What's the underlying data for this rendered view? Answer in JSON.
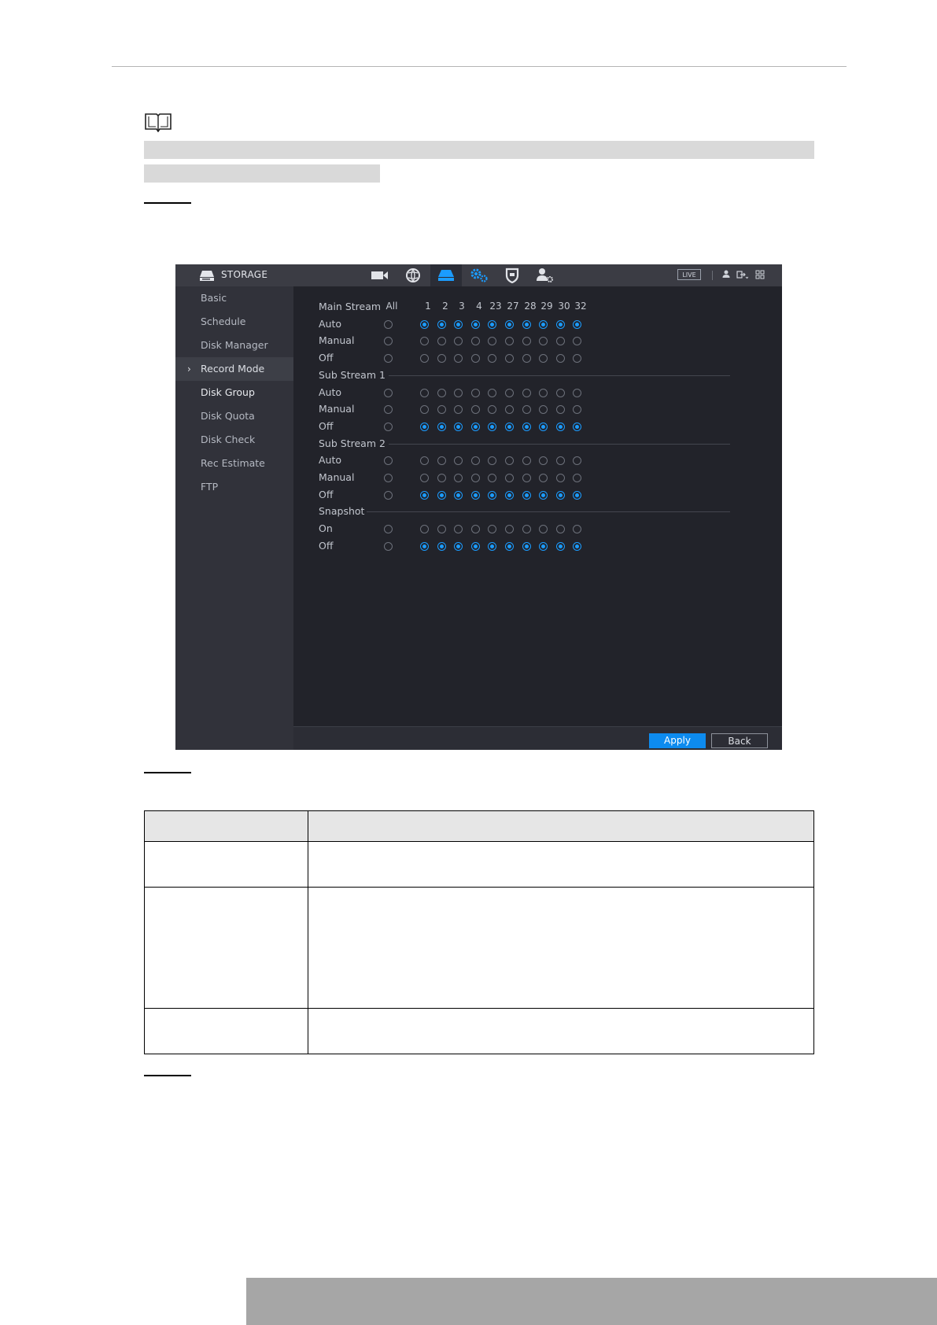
{
  "screen": {
    "title": "STORAGE",
    "live_label": "LIVE",
    "nav_icons": [
      "camera-icon",
      "network-icon",
      "storage-icon",
      "system-gear-icon",
      "shield-icon",
      "account-icon"
    ],
    "sidebar": {
      "items": [
        "Basic",
        "Schedule",
        "Disk Manager",
        "Record Mode",
        "Disk Group",
        "Disk Quota",
        "Disk Check",
        "Rec Estimate",
        "FTP"
      ],
      "active": "Record Mode",
      "arrow": "›"
    },
    "columns": {
      "all": "All",
      "channels": [
        "1",
        "2",
        "3",
        "4",
        "23",
        "27",
        "28",
        "29",
        "30",
        "32"
      ]
    },
    "sections": [
      {
        "title": "Main Stream",
        "rows": [
          {
            "label": "Auto",
            "all": false,
            "channels_on": true
          },
          {
            "label": "Manual",
            "all": false,
            "channels_on": false
          },
          {
            "label": "Off",
            "all": false,
            "channels_on": false
          }
        ]
      },
      {
        "title": "Sub Stream 1",
        "rows": [
          {
            "label": "Auto",
            "all": false,
            "channels_on": false
          },
          {
            "label": "Manual",
            "all": false,
            "channels_on": false
          },
          {
            "label": "Off",
            "all": false,
            "channels_on": true
          }
        ]
      },
      {
        "title": "Sub Stream 2",
        "rows": [
          {
            "label": "Auto",
            "all": false,
            "channels_on": false
          },
          {
            "label": "Manual",
            "all": false,
            "channels_on": false
          },
          {
            "label": "Off",
            "all": false,
            "channels_on": true
          }
        ]
      },
      {
        "title": "Snapshot",
        "rows": [
          {
            "label": "On",
            "all": false,
            "channels_on": false
          },
          {
            "label": "Off",
            "all": false,
            "channels_on": true
          }
        ]
      }
    ],
    "buttons": {
      "apply": "Apply",
      "back": "Back"
    },
    "colors": {
      "accent": "#1b9cff",
      "apply_button": "#0d8bef",
      "background": "#22232a"
    }
  }
}
